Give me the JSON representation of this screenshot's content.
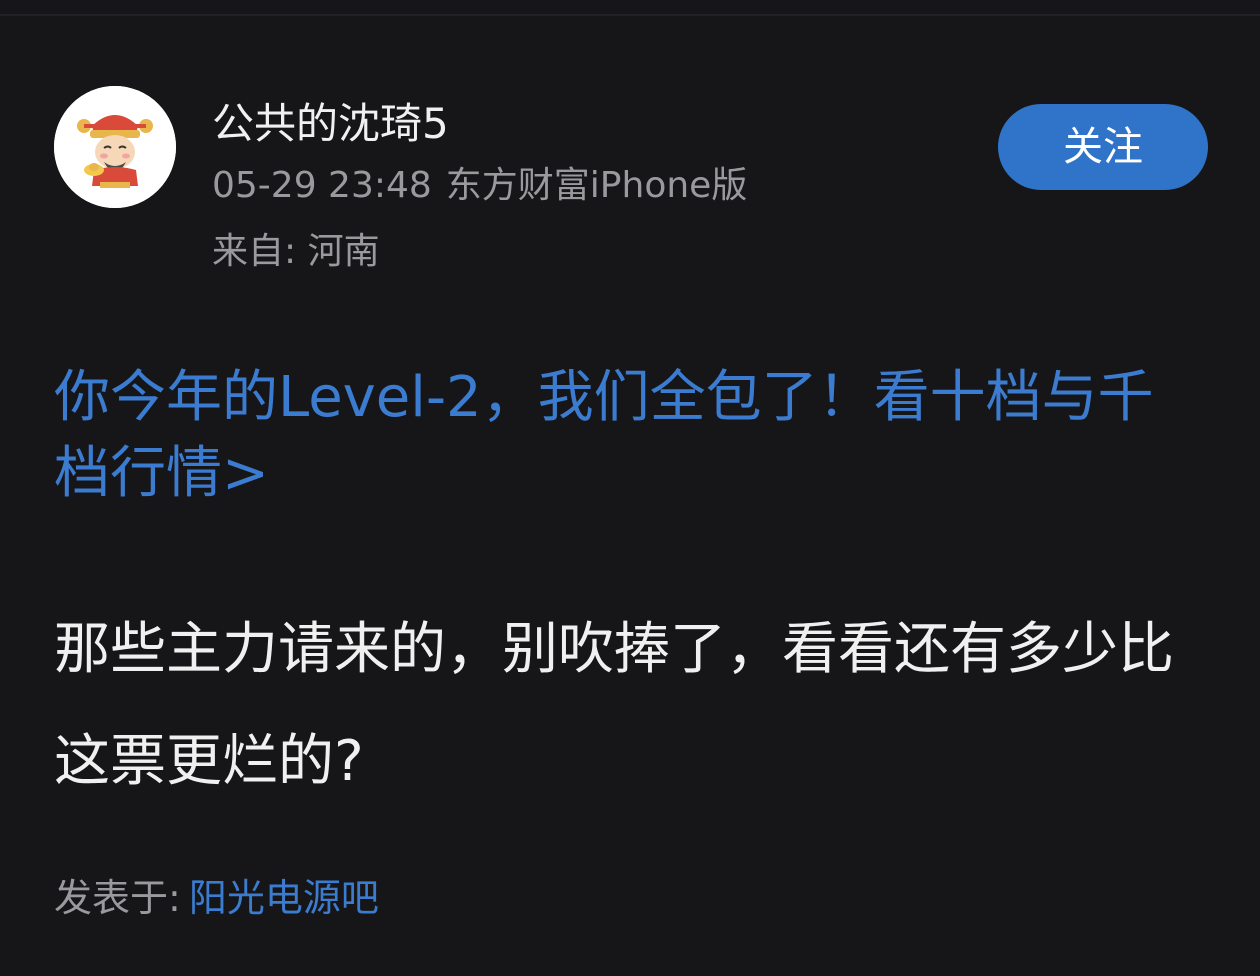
{
  "author": {
    "name": "公共的沈琦5",
    "avatar_icon": "caishen-avatar-icon"
  },
  "meta": {
    "timestamp": "05-29 23:48",
    "client": "东方财富iPhone版",
    "location": "来自: 河南"
  },
  "follow_button": {
    "label": "关注",
    "color": "#2f74c8"
  },
  "promo": {
    "text": "你今年的Level-2，我们全包了！看十档与千档行情>",
    "color": "#3b7cd0"
  },
  "post": {
    "body": "那些主力请来的，别吹捧了，看看还有多少比这票更烂的?"
  },
  "footer": {
    "label": "发表于:",
    "forum": "阳光电源吧"
  },
  "colors": {
    "background": "#161618",
    "accent": "#3b7cd0",
    "muted_text": "#9a9a9e"
  }
}
